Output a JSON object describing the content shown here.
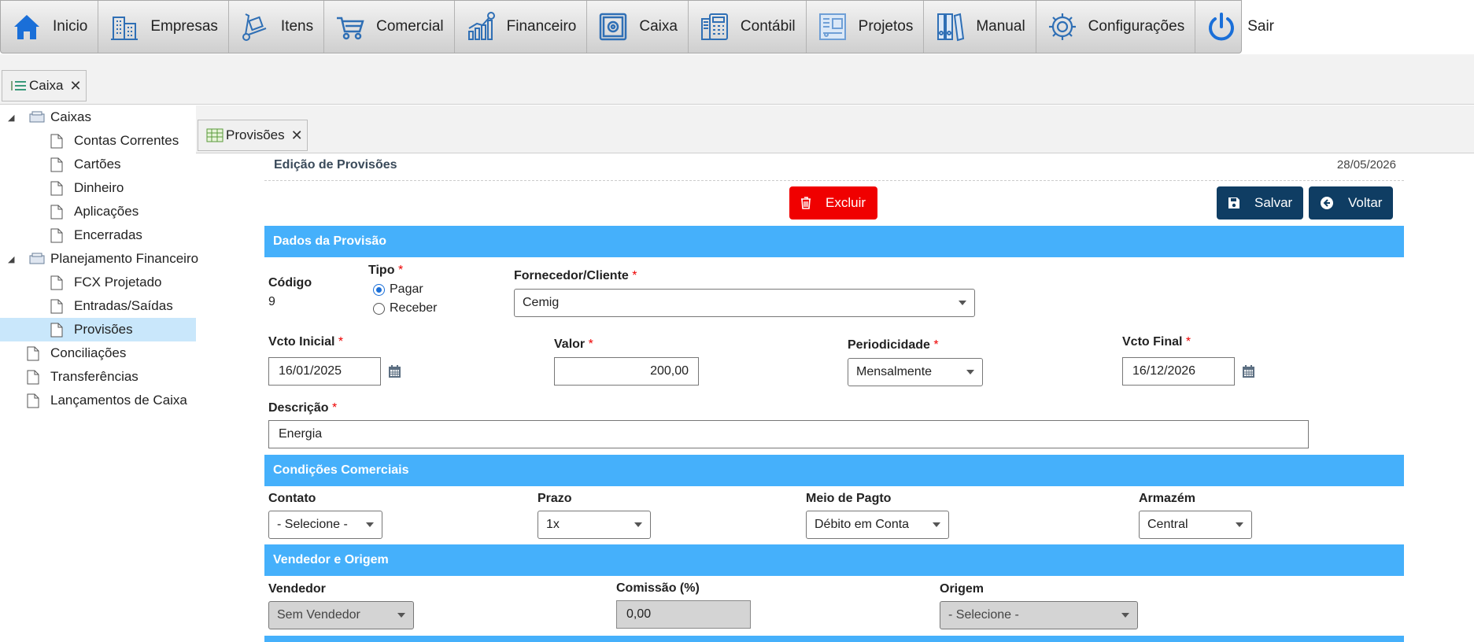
{
  "toolbar": {
    "items": [
      {
        "label": "Inicio",
        "icon": "home-icon"
      },
      {
        "label": "Empresas",
        "icon": "building-icon"
      },
      {
        "label": "Itens",
        "icon": "hand-truck-icon"
      },
      {
        "label": "Comercial",
        "icon": "shopping-cart-icon"
      },
      {
        "label": "Financeiro",
        "icon": "chart-growth-icon"
      },
      {
        "label": "Caixa",
        "icon": "safe-icon"
      },
      {
        "label": "Contábil",
        "icon": "calculator-icon"
      },
      {
        "label": "Projetos",
        "icon": "blueprint-icon"
      },
      {
        "label": "Manual",
        "icon": "binders-icon"
      },
      {
        "label": "Configurações",
        "icon": "gear-icon"
      },
      {
        "label": "Sair",
        "icon": "power-icon"
      }
    ]
  },
  "window_tab": {
    "label": "Caixa"
  },
  "tree": {
    "items": [
      {
        "label": "Caixas"
      },
      {
        "label": "Contas Correntes"
      },
      {
        "label": "Cartões"
      },
      {
        "label": "Dinheiro"
      },
      {
        "label": "Aplicações"
      },
      {
        "label": "Encerradas"
      },
      {
        "label": "Planejamento Financeiro"
      },
      {
        "label": "FCX Projetado"
      },
      {
        "label": "Entradas/Saídas"
      },
      {
        "label": "Provisões"
      },
      {
        "label": "Conciliações"
      },
      {
        "label": "Transferências"
      },
      {
        "label": "Lançamentos de Caixa"
      }
    ]
  },
  "doc_tab": {
    "label": "Provisões"
  },
  "form": {
    "title": "Edição de Provisões",
    "date": "28/05/2026",
    "buttons": {
      "delete": "Excluir",
      "save": "Salvar",
      "back": "Voltar"
    },
    "sections": {
      "dados": "Dados da Provisão",
      "condicoes": "Condições Comerciais",
      "vendedor": "Vendedor e Origem"
    },
    "required_mark": "*",
    "codigo": {
      "label": "Código",
      "value": "9"
    },
    "tipo": {
      "label": "Tipo",
      "options": [
        "Pagar",
        "Receber"
      ],
      "selected": "Pagar"
    },
    "fornecedor": {
      "label": "Fornecedor/Cliente",
      "value": "Cemig"
    },
    "vcto_inicial": {
      "label": "Vcto Inicial",
      "value": "16/01/2025"
    },
    "valor": {
      "label": "Valor",
      "value": "200,00"
    },
    "periodicidade": {
      "label": "Periodicidade",
      "value": "Mensalmente"
    },
    "vcto_final": {
      "label": "Vcto Final",
      "value": "16/12/2026"
    },
    "descricao": {
      "label": "Descrição",
      "value": "Energia"
    },
    "contato": {
      "label": "Contato",
      "value": "- Selecione -"
    },
    "prazo": {
      "label": "Prazo",
      "value": "1x"
    },
    "meio_pagto": {
      "label": "Meio de Pagto",
      "value": "Débito em Conta"
    },
    "armazem": {
      "label": "Armazém",
      "value": "Central"
    },
    "vendedor": {
      "label": "Vendedor",
      "value": "Sem Vendedor"
    },
    "comissao": {
      "label": "Comissão (%)",
      "value": "0,00"
    },
    "origem": {
      "label": "Origem",
      "value": "- Selecione -"
    }
  },
  "colors": {
    "section_header": "#45b0fb",
    "delete_button": "#f00000",
    "primary_button": "#0f3d63",
    "tree_selected": "#c9e7fb",
    "required_asterisk": "#ee0000",
    "icon_blue": "#1a6fd8"
  }
}
